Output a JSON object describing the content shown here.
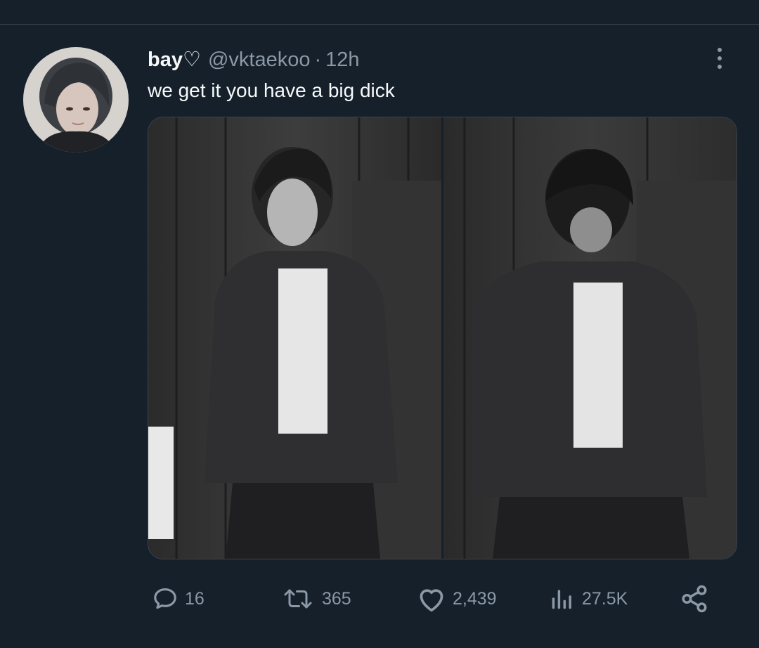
{
  "tweet": {
    "display_name": "bay♡",
    "handle": "@vktaekoo",
    "separator": "·",
    "time": "12h",
    "text": "we get it you have a big dick"
  },
  "actions": {
    "reply_count": "16",
    "retweet_count": "365",
    "like_count": "2,439",
    "view_count": "27.5K"
  },
  "icons": {
    "more": "more-icon",
    "reply": "reply-icon",
    "retweet": "retweet-icon",
    "like": "heart-icon",
    "views": "views-icon",
    "share": "share-icon"
  },
  "colors": {
    "background": "#15202b",
    "text_primary": "#f7f9f9",
    "text_secondary": "#8b98a5",
    "border": "#38444d"
  }
}
